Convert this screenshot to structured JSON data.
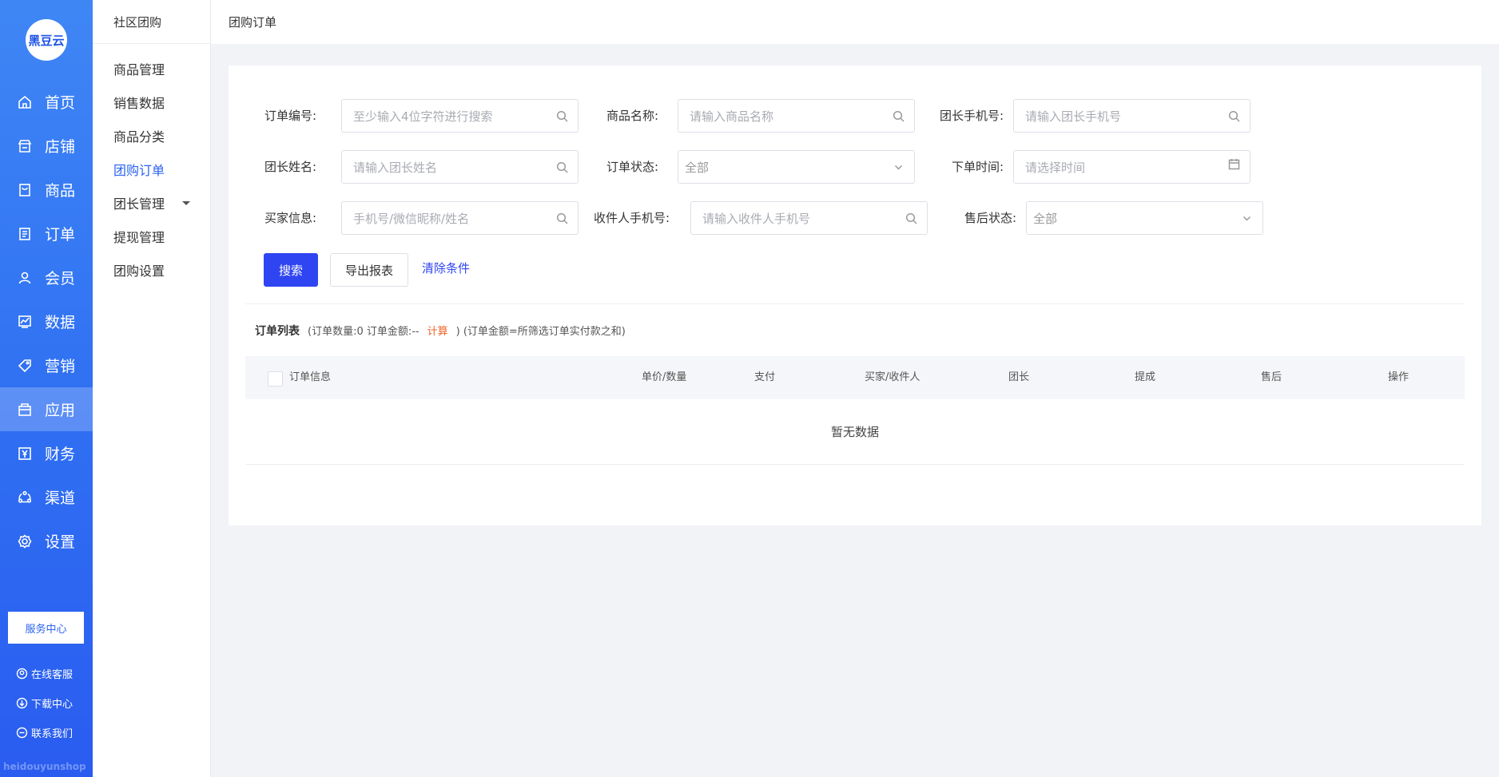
{
  "brand": {
    "logo_text": "黑豆云",
    "watermark": "heidouyunshop"
  },
  "nav": {
    "items": [
      {
        "label": "首页",
        "icon": "home-icon"
      },
      {
        "label": "店铺",
        "icon": "store-icon"
      },
      {
        "label": "商品",
        "icon": "goods-icon"
      },
      {
        "label": "订单",
        "icon": "order-icon"
      },
      {
        "label": "会员",
        "icon": "user-icon"
      },
      {
        "label": "数据",
        "icon": "chart-icon"
      },
      {
        "label": "营销",
        "icon": "tag-icon"
      },
      {
        "label": "应用",
        "icon": "app-icon",
        "active": true
      },
      {
        "label": "财务",
        "icon": "finance-icon"
      },
      {
        "label": "渠道",
        "icon": "channel-icon"
      },
      {
        "label": "设置",
        "icon": "gear-icon"
      }
    ]
  },
  "service": {
    "center_label": "服务中心",
    "links": [
      {
        "label": "在线客服",
        "icon": "support-icon"
      },
      {
        "label": "下载中心",
        "icon": "download-icon"
      },
      {
        "label": "联系我们",
        "icon": "contact-icon"
      }
    ]
  },
  "subnav": {
    "title": "社区团购",
    "items": [
      {
        "label": "商品管理"
      },
      {
        "label": "销售数据"
      },
      {
        "label": "商品分类"
      },
      {
        "label": "团购订单",
        "active": true
      },
      {
        "label": "团长管理",
        "has_caret": true
      },
      {
        "label": "提现管理"
      },
      {
        "label": "团购设置"
      }
    ]
  },
  "topbar": {
    "title": "团购订单"
  },
  "filters": {
    "order_no": {
      "label": "订单编号:",
      "placeholder": "至少输入4位字符进行搜索"
    },
    "product_name": {
      "label": "商品名称:",
      "placeholder": "请输入商品名称"
    },
    "leader_phone": {
      "label": "团长手机号:",
      "placeholder": "请输入团长手机号"
    },
    "leader_name": {
      "label": "团长姓名:",
      "placeholder": "请输入团长姓名"
    },
    "order_status": {
      "label": "订单状态:",
      "value": "全部"
    },
    "order_time": {
      "label": "下单时间:",
      "placeholder": "请选择时间"
    },
    "buyer_info": {
      "label": "买家信息:",
      "placeholder": "手机号/微信昵称/姓名"
    },
    "receiver_phone": {
      "label": "收件人手机号:",
      "placeholder": "请输入收件人手机号"
    },
    "aftersale_status": {
      "label": "售后状态:",
      "value": "全部"
    }
  },
  "actions": {
    "search": "搜索",
    "export": "导出报表",
    "clear": "清除条件"
  },
  "list": {
    "title": "订单列表",
    "meta_prefix": "(订单数量:0 订单金额:--",
    "calc_label": "计算",
    "meta_suffix": ") (订单金额=所筛选订单实付款之和)",
    "columns": [
      "订单信息",
      "单价/数量",
      "支付",
      "买家/收件人",
      "团长",
      "提成",
      "售后",
      "操作"
    ],
    "empty_text": "暂无数据"
  }
}
